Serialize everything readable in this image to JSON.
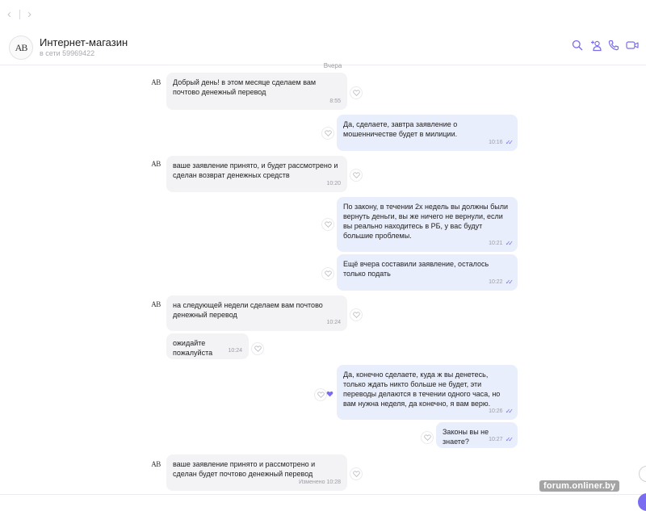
{
  "header": {
    "avatar_initials": "AB",
    "title": "Интернет-магазин",
    "subtitle": "в сети 59969422"
  },
  "date_separator": "Вчера",
  "messages": [
    {
      "dir": "in",
      "text": "Добрый день! в этом месяце сделаем вам почтово денежный перевод",
      "time": "8:55"
    },
    {
      "dir": "out",
      "text": "Да, сделаете, завтра заявление о мошенничестве будет в милиции.",
      "time": "10:16"
    },
    {
      "dir": "in",
      "text": "ваше заявление принято, и будет рассмотрено и сделан возврат денежных средств",
      "time": "10:20"
    },
    {
      "dir": "out",
      "text": "По закону, в течении 2х недель вы должны были вернуть деньги, вы же ничего не вернули, если вы реально находитесь в РБ, у вас будут большие проблемы.",
      "time": "10:21"
    },
    {
      "dir": "out",
      "text": "Ещё вчера составили заявление, осталось только подать",
      "time": "10:22"
    },
    {
      "dir": "in",
      "text": "на следующей недели сделаем вам почтово денежный перевод",
      "time": "10:24"
    },
    {
      "dir": "in",
      "text": "ожидайте пожалуйста",
      "time": "10:24"
    },
    {
      "dir": "out",
      "text": "Да, конечно сделаете, куда ж вы денетесь, только ждать никто больше не будет, эти переводы делаются в течении одного часа, но вам нужна неделя, да конечно, я вам верю.",
      "time": "10:26"
    },
    {
      "dir": "out",
      "text": "Законы вы не знаете?",
      "time": "10:27"
    },
    {
      "dir": "in",
      "text": "ваше заявление принято и рассмотрено и сделан будет почтово денежный перевод",
      "time": "Изменено 10:28"
    }
  ],
  "watermark": "forum.onliner.by",
  "colors": {
    "accent": "#7a6cf0",
    "incoming_bubble": "#f3f3f5",
    "outgoing_bubble": "#e9eefc"
  },
  "icons": {
    "back": "chevron-left-icon",
    "forward": "chevron-right-icon",
    "search": "search-icon",
    "add_user": "add-user-icon",
    "call": "phone-icon",
    "video": "video-icon",
    "like": "heart-icon",
    "read": "double-check-icon"
  }
}
